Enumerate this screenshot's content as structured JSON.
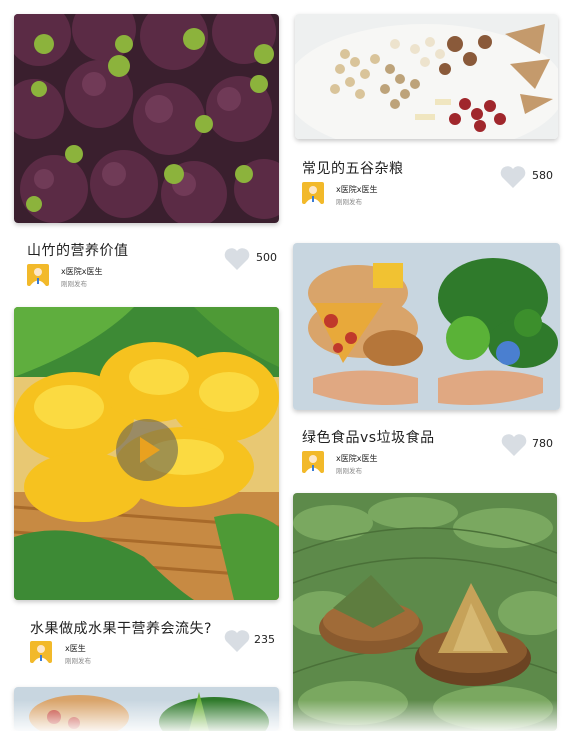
{
  "feed": {
    "cards": [
      {
        "title": "山竹的营养价值",
        "author": "x医院x医生",
        "time": "刚刚发布",
        "likes": "500",
        "image": "mangosteen-photo"
      },
      {
        "title": "常见的五谷杂粮",
        "author": "x医院x医生",
        "time": "刚刚发布",
        "likes": "580",
        "image": "grains-photo"
      },
      {
        "title": "水果做成水果干营养会流失?",
        "author": "x医生",
        "time": "刚刚发布",
        "likes": "235",
        "image": "dried-fruit-video"
      },
      {
        "title": "绿色食品vs垃圾食品",
        "author": "x医院x医生",
        "time": "刚刚发布",
        "likes": "780",
        "image": "green-vs-junk-food-photo"
      },
      {
        "image": "zongzi-photo"
      },
      {
        "image": "green-vs-junk-food-photo-repeat"
      }
    ]
  },
  "icons": {
    "like": "heart-icon",
    "play": "play-icon",
    "doctor": "doctor-avatar-icon"
  },
  "colors": {
    "avatar_bg": "#f2b92a",
    "heart": "#d8dde3",
    "text": "#222222"
  }
}
